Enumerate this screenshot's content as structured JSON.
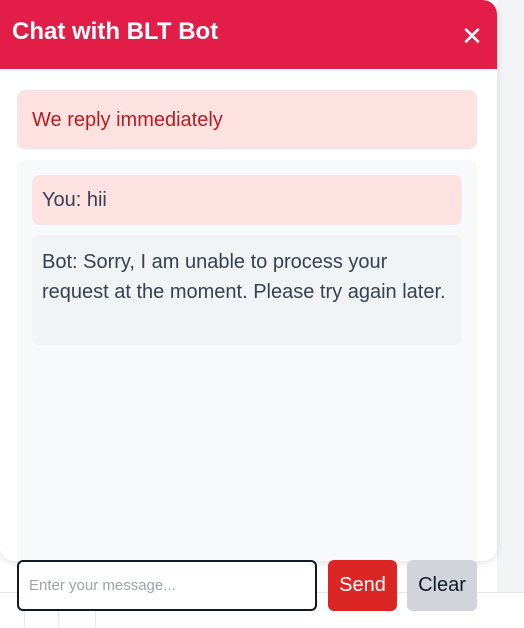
{
  "chat": {
    "title": "Chat with BLT Bot",
    "close_glyph": "✕",
    "notice": "We reply immediately",
    "messages": [
      {
        "sender": "user",
        "text": "You: hii"
      },
      {
        "sender": "bot",
        "text": "Bot: Sorry, I am unable to process your request at the moment. Please try again later."
      }
    ]
  },
  "composer": {
    "value": "",
    "placeholder": "Enter your message...",
    "send_label": "Send",
    "clear_label": "Clear"
  },
  "colors": {
    "header": "#e11d48",
    "notice_bg": "#fee2e2",
    "notice_text": "#b91c1c",
    "send_button": "#dc2626",
    "clear_button": "#d1d5db"
  }
}
